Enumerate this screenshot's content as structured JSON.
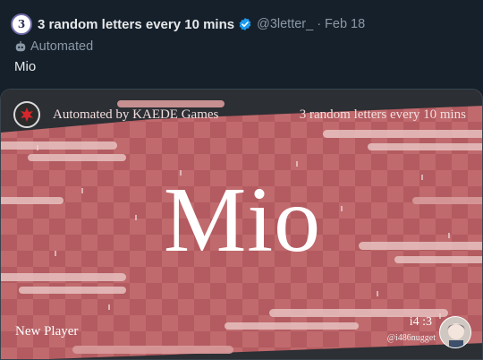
{
  "post": {
    "avatar_text": "3",
    "display_name": "3 random letters every 10 mins",
    "handle": "@3letter_",
    "separator": "·",
    "date": "Feb 18",
    "automated_label": "Automated",
    "text": "Mio"
  },
  "card": {
    "logo_label": "Automated by KAEDE Games",
    "title": "3 random letters every 10 mins",
    "name": "Mio",
    "footer_left": "New Player",
    "credit_line": "i4 :3",
    "credit_handle": "@i486nugget"
  },
  "colors": {
    "background": "#15202b",
    "verified": "#1d9bf0",
    "banner": "#b85f63",
    "banner_light": "#c98a8a",
    "dark_band": "#2c2f34"
  },
  "icons": {
    "verified": "verified-badge-icon",
    "bot": "bot-icon",
    "logo": "kaede-logo-icon"
  }
}
